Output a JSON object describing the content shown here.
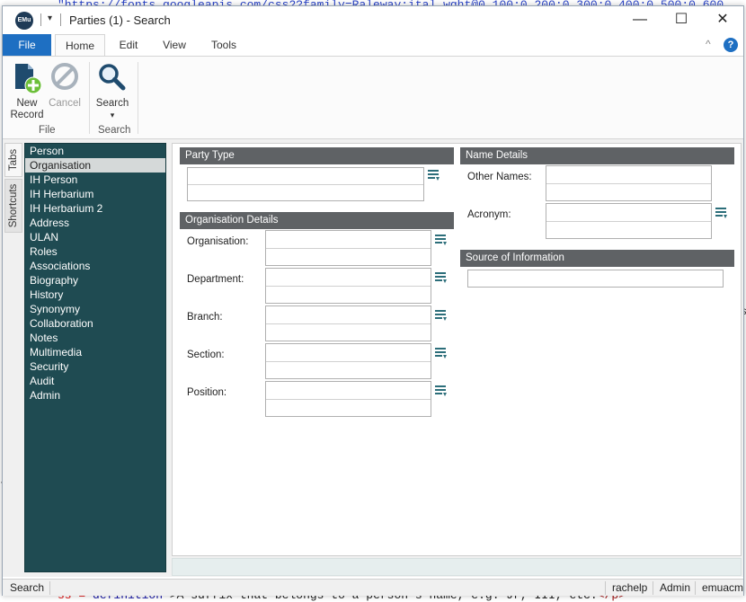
{
  "background": {
    "top_code": "\"https://fonts.googleapis.com/css2?family=Raleway:ital,wght@0,100;0,200;0,300;0,400;0,500;0,600",
    "bottom_code_a": "ss =",
    "bottom_code_b": "\"definition\"",
    "bottom_code_c": ">A suffix that belongs to a person's name, e.g. Jr, III, etc.",
    "bottom_code_d": "</p>",
    "right_char": "s",
    "left_char": "t"
  },
  "window": {
    "app_icon": "EMu",
    "title": "Parties (1) - Search",
    "qat_arrow": "▾",
    "min": "—",
    "max": "☐",
    "close": "✕"
  },
  "menu": {
    "tabs": [
      "File",
      "Home",
      "Edit",
      "View",
      "Tools"
    ],
    "collapse": "^",
    "help": "?"
  },
  "ribbon": {
    "new_label1": "New",
    "new_label2": "Record",
    "cancel_label": "Cancel",
    "search_label": "Search",
    "search_arrow": "▾",
    "group_file": "File",
    "group_search": "Search"
  },
  "side_tabs": {
    "tabs": "Tabs",
    "shortcuts": "Shortcuts"
  },
  "nav": {
    "items": [
      "Person",
      "Organisation",
      "IH Person",
      "IH Herbarium",
      "IH Herbarium 2",
      "Address",
      "ULAN",
      "Roles",
      "Associations",
      "Biography",
      "History",
      "Synonymy",
      "Collaboration",
      "Notes",
      "Multimedia",
      "Security",
      "Audit",
      "Admin"
    ],
    "selected": "Organisation"
  },
  "form": {
    "party_type": "Party Type",
    "org_details": "Organisation Details",
    "organisation": "Organisation:",
    "department": "Department:",
    "branch": "Branch:",
    "section": "Section:",
    "position": "Position:",
    "name_details": "Name Details",
    "other_names": "Other Names:",
    "acronym": "Acronym:",
    "source": "Source of Information"
  },
  "status": {
    "mode": "Search",
    "user": "rachelp",
    "role": "Admin",
    "db": "emuacm"
  },
  "colors": {
    "accent": "#1e6fc2",
    "nav_bg": "#1f4b52",
    "section_header": "#5f6265"
  }
}
